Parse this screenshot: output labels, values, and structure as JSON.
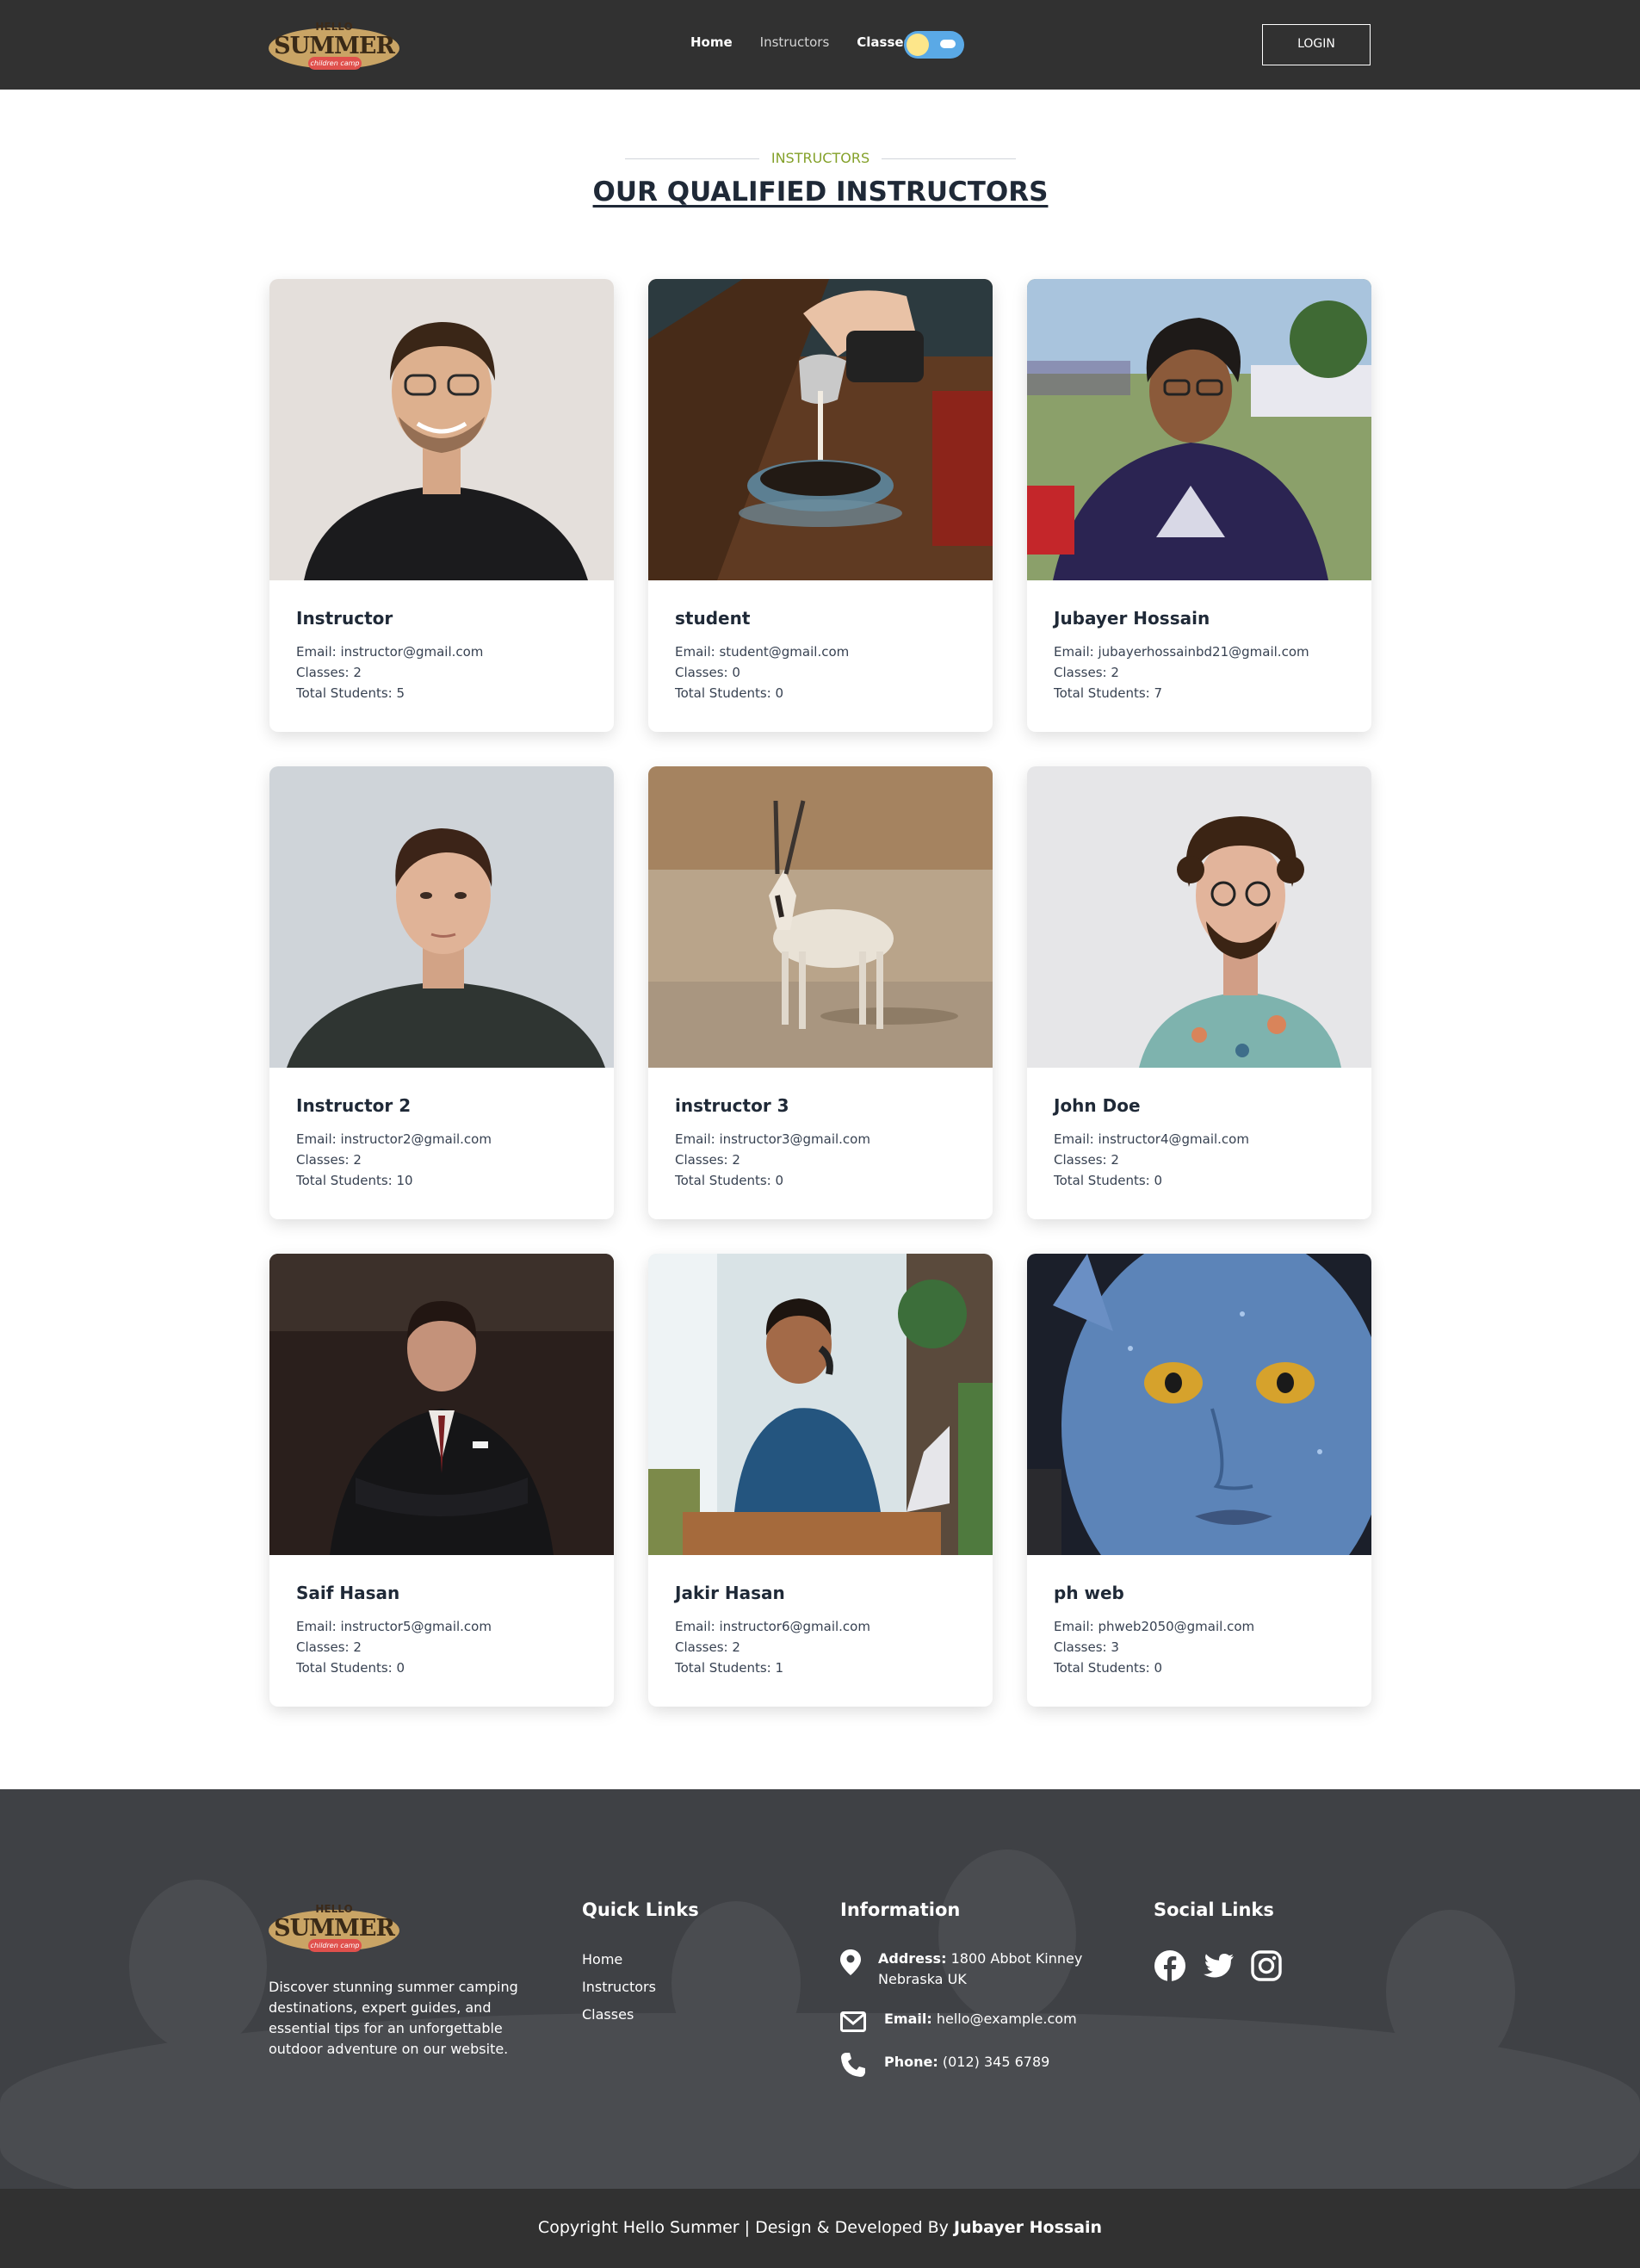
{
  "brand": {
    "hello": "HELLO",
    "summer": "SUMMER",
    "tagline": "children camp"
  },
  "nav": {
    "items": [
      "Home",
      "Instructors",
      "Classes"
    ],
    "login_label": "LOGIN"
  },
  "section": {
    "eyebrow": "INSTRUCTORS",
    "title": "OUR QUALIFIED INSTRUCTORS"
  },
  "instructors": [
    {
      "name": "Instructor",
      "email": "Email: instructor@gmail.com",
      "classes": "Classes: 2",
      "students": "Total Students: 5"
    },
    {
      "name": "student",
      "email": "Email: student@gmail.com",
      "classes": "Classes: 0",
      "students": "Total Students: 0"
    },
    {
      "name": "Jubayer Hossain",
      "email": "Email: jubayerhossainbd21@gmail.com",
      "classes": "Classes: 2",
      "students": "Total Students: 7"
    },
    {
      "name": "Instructor 2",
      "email": "Email: instructor2@gmail.com",
      "classes": "Classes: 2",
      "students": "Total Students: 10"
    },
    {
      "name": "instructor 3",
      "email": "Email: instructor3@gmail.com",
      "classes": "Classes: 2",
      "students": "Total Students: 0"
    },
    {
      "name": "John Doe",
      "email": "Email: instructor4@gmail.com",
      "classes": "Classes: 2",
      "students": "Total Students: 0"
    },
    {
      "name": "Saif Hasan",
      "email": "Email: instructor5@gmail.com",
      "classes": "Classes: 2",
      "students": "Total Students: 0"
    },
    {
      "name": "Jakir Hasan",
      "email": "Email: instructor6@gmail.com",
      "classes": "Classes: 2",
      "students": "Total Students: 1"
    },
    {
      "name": "ph web",
      "email": "Email: phweb2050@gmail.com",
      "classes": "Classes: 3",
      "students": "Total Students: 0"
    }
  ],
  "footer": {
    "description": "Discover stunning summer camping destinations, expert guides, and essential tips for an unforgettable outdoor adventure on our website.",
    "quick_links_title": "Quick Links",
    "quick_links": [
      "Home",
      "Instructors",
      "Classes"
    ],
    "info_title": "Information",
    "address_label": "Address:",
    "address_value": "1800 Abbot Kinney",
    "address_value2": "Nebraska UK",
    "email_label": "Email:",
    "email_value": "hello@example.com",
    "phone_label": "Phone:",
    "phone_value": "(012) 345 6789",
    "social_title": "Social Links",
    "social_icons": [
      "facebook-icon",
      "twitter-icon",
      "instagram-icon"
    ],
    "copyright_prefix": "Copyright Hello Summer | Design & Developed By",
    "copyright_author": "Jubayer Hossain"
  },
  "colors": {
    "navbar": "#313131",
    "accent": "#84a12a",
    "footer": "#3f4145",
    "toggle": "#5aa9e6"
  }
}
